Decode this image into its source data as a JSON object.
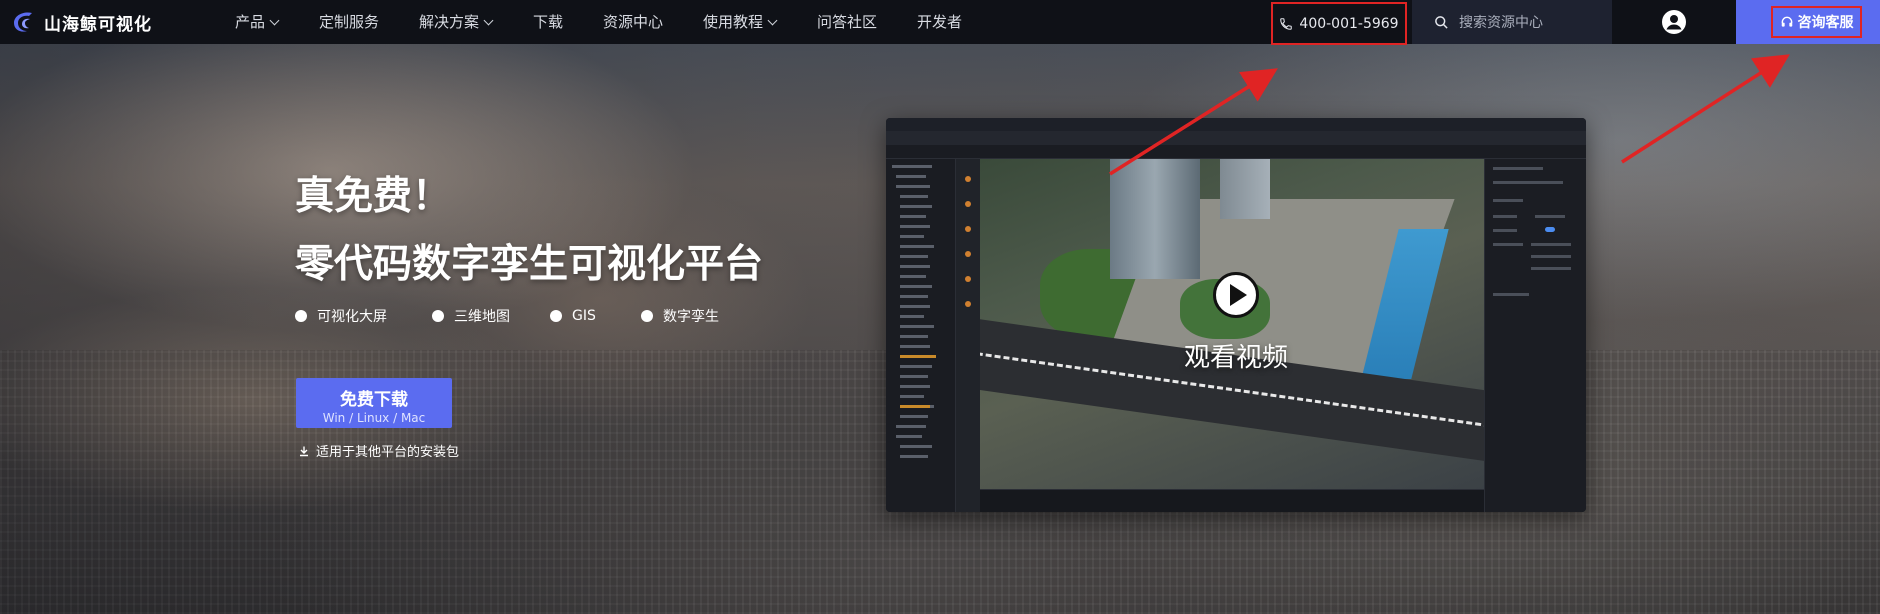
{
  "brand": {
    "name": "山海鲸可视化",
    "logo_icon": "whale-logo-icon",
    "accent_color": "#5b6cf0"
  },
  "nav": {
    "items": [
      {
        "label": "产品",
        "has_dropdown": true
      },
      {
        "label": "定制服务",
        "has_dropdown": false
      },
      {
        "label": "解决方案",
        "has_dropdown": true
      },
      {
        "label": "下载",
        "has_dropdown": false
      },
      {
        "label": "资源中心",
        "has_dropdown": false
      },
      {
        "label": "使用教程",
        "has_dropdown": true
      },
      {
        "label": "问答社区",
        "has_dropdown": false
      },
      {
        "label": "开发者",
        "has_dropdown": false
      }
    ],
    "phone": "400-001-5969",
    "search_placeholder": "搜索资源中心",
    "consult_label": "咨询客服"
  },
  "hero": {
    "title_line1": "真免费！",
    "title_line2": "零代码数字孪生可视化平台",
    "features": [
      "可视化大屏",
      "三维地图",
      "GIS",
      "数字孪生"
    ],
    "download_label": "免费下载",
    "download_platforms": "Win / Linux / Mac",
    "other_packages_label": "适用于其他平台的安装包"
  },
  "video": {
    "watch_label": "观看视频"
  },
  "annotation_color": "#e02424"
}
